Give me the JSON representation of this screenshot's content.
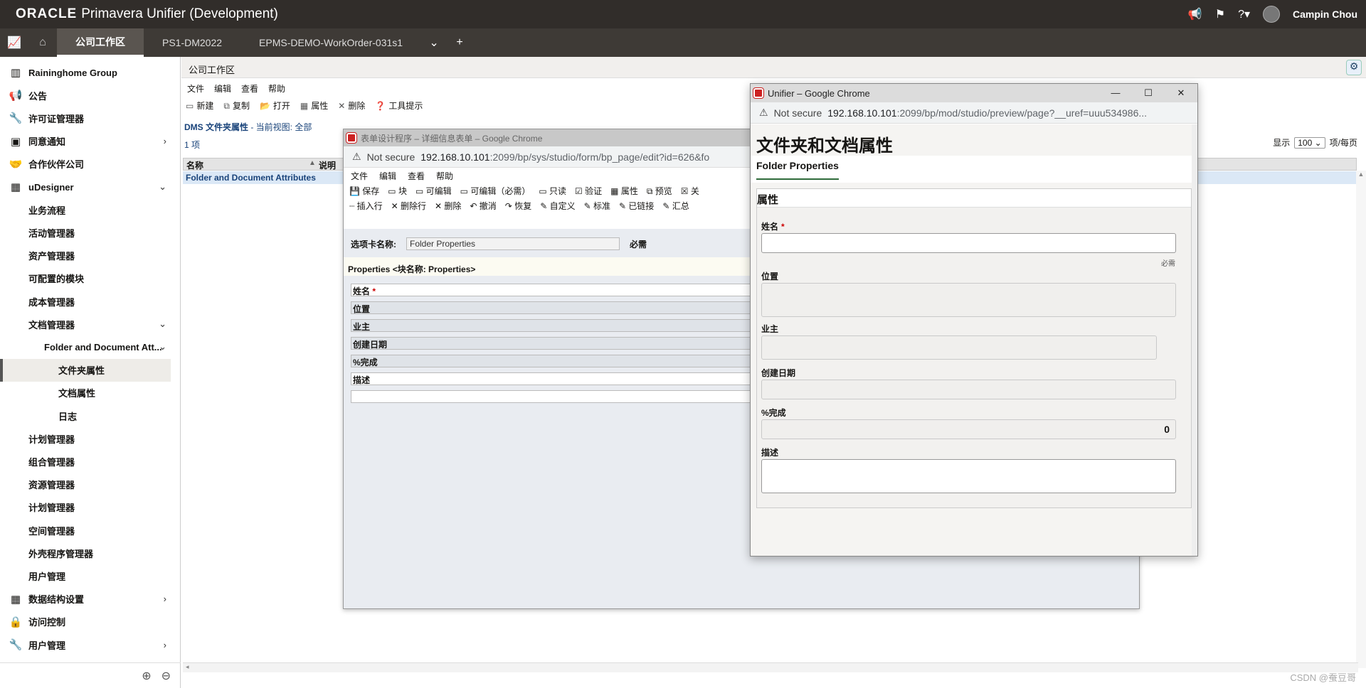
{
  "header": {
    "brand_oracle": "ORACLE",
    "brand_product": "Primavera Unifier",
    "brand_env": "(Development)",
    "user_name": "Campin Chou"
  },
  "tabs": [
    {
      "label": "公司工作区",
      "active": true
    },
    {
      "label": "PS1-DM2022",
      "active": false
    },
    {
      "label": "EPMS-DEMO-WorkOrder-031s1",
      "active": false
    }
  ],
  "sidebar": {
    "items": [
      {
        "label": "Raininghome Group",
        "icon": "building-icon",
        "indent": 0
      },
      {
        "label": "公告",
        "icon": "megaphone-icon",
        "indent": 0
      },
      {
        "label": "许可证管理器",
        "icon": "wrench-icon",
        "indent": 0
      },
      {
        "label": "同意通知",
        "icon": "id-card-icon",
        "indent": 0,
        "chev": "›"
      },
      {
        "label": "合作伙伴公司",
        "icon": "handshake-icon",
        "indent": 0
      },
      {
        "label": "uDesigner",
        "icon": "grid-icon",
        "indent": 0,
        "chev": "⌄"
      },
      {
        "label": "业务流程",
        "indent": 1
      },
      {
        "label": "活动管理器",
        "indent": 1
      },
      {
        "label": "资产管理器",
        "indent": 1
      },
      {
        "label": "可配置的模块",
        "indent": 1
      },
      {
        "label": "成本管理器",
        "indent": 1
      },
      {
        "label": "文档管理器",
        "indent": 1,
        "chev": "⌄"
      },
      {
        "label": "Folder and Document Att...",
        "indent": 2,
        "chev": "⌄"
      },
      {
        "label": "文件夹属性",
        "indent": 3,
        "selected": true
      },
      {
        "label": "文档属性",
        "indent": 3
      },
      {
        "label": "日志",
        "indent": 3
      },
      {
        "label": "计划管理器",
        "indent": 1
      },
      {
        "label": "组合管理器",
        "indent": 1
      },
      {
        "label": "资源管理器",
        "indent": 1
      },
      {
        "label": "计划管理器",
        "indent": 1
      },
      {
        "label": "空间管理器",
        "indent": 1
      },
      {
        "label": "外壳程序管理器",
        "indent": 1
      },
      {
        "label": "用户管理",
        "indent": 1
      },
      {
        "label": "数据结构设置",
        "icon": "grid-icon",
        "indent": 0,
        "chev": "›"
      },
      {
        "label": "访问控制",
        "icon": "lock-icon",
        "indent": 0
      },
      {
        "label": "用户管理",
        "icon": "wrench-icon",
        "indent": 0,
        "chev": "›"
      }
    ]
  },
  "main": {
    "title": "公司工作区",
    "menu": [
      "文件",
      "编辑",
      "查看",
      "帮助"
    ],
    "toolbar": [
      "新建",
      "复制",
      "打开",
      "属性",
      "删除",
      "工具提示"
    ],
    "dms_label": "DMS 文件夹属性",
    "view_label": " - 当前视图: ",
    "view_value": "全部",
    "count": "1 项",
    "grid_col_name": "名称",
    "grid_col_desc": "说明",
    "grid_row": "Folder and Document Attributes",
    "show_label": "显示",
    "per_page_value": "100",
    "per_page_suffix": "项/每页"
  },
  "win1": {
    "title": "表单设计程序 – 详细信息表单 – Google Chrome",
    "not_secure": "Not secure",
    "url_host": "192.168.10.101",
    "url_path": ":2099/bp/sys/studio/form/bp_page/edit?id=626&fo",
    "menu": [
      "文件",
      "编辑",
      "查看",
      "帮助"
    ],
    "toolbar1": [
      "保存",
      "块",
      "可编辑",
      "可编辑（必需）",
      "只读",
      "验证",
      "属性",
      "预览",
      "关"
    ],
    "toolbar2": [
      "插入行",
      "删除行",
      "删除",
      "撤消",
      "恢复",
      "自定义",
      "标准",
      "已链接",
      "汇总"
    ],
    "tab_name_label": "选项卡名称:",
    "tab_name_value": "Folder Properties",
    "required": "必需",
    "block_title": "Properties <块名称: Properties>",
    "fields": [
      "姓名",
      "位置",
      "业主",
      "创建日期",
      "%完成",
      "描述",
      ""
    ]
  },
  "win2": {
    "title": "Unifier – Google Chrome",
    "not_secure": "Not secure",
    "url_host": "192.168.10.101",
    "url_path": ":2099/bp/mod/studio/preview/page?__uref=uuu534986...",
    "page_title": "文件夹和文档属性",
    "tab": "Folder Properties",
    "section": "属性",
    "f_name": "姓名",
    "f_required": "必需",
    "f_location": "位置",
    "f_owner": "业主",
    "f_created": "创建日期",
    "f_percent": "%完成",
    "f_percent_value": "0",
    "f_desc": "描述"
  },
  "watermark": "CSDN @蚕豆哥"
}
